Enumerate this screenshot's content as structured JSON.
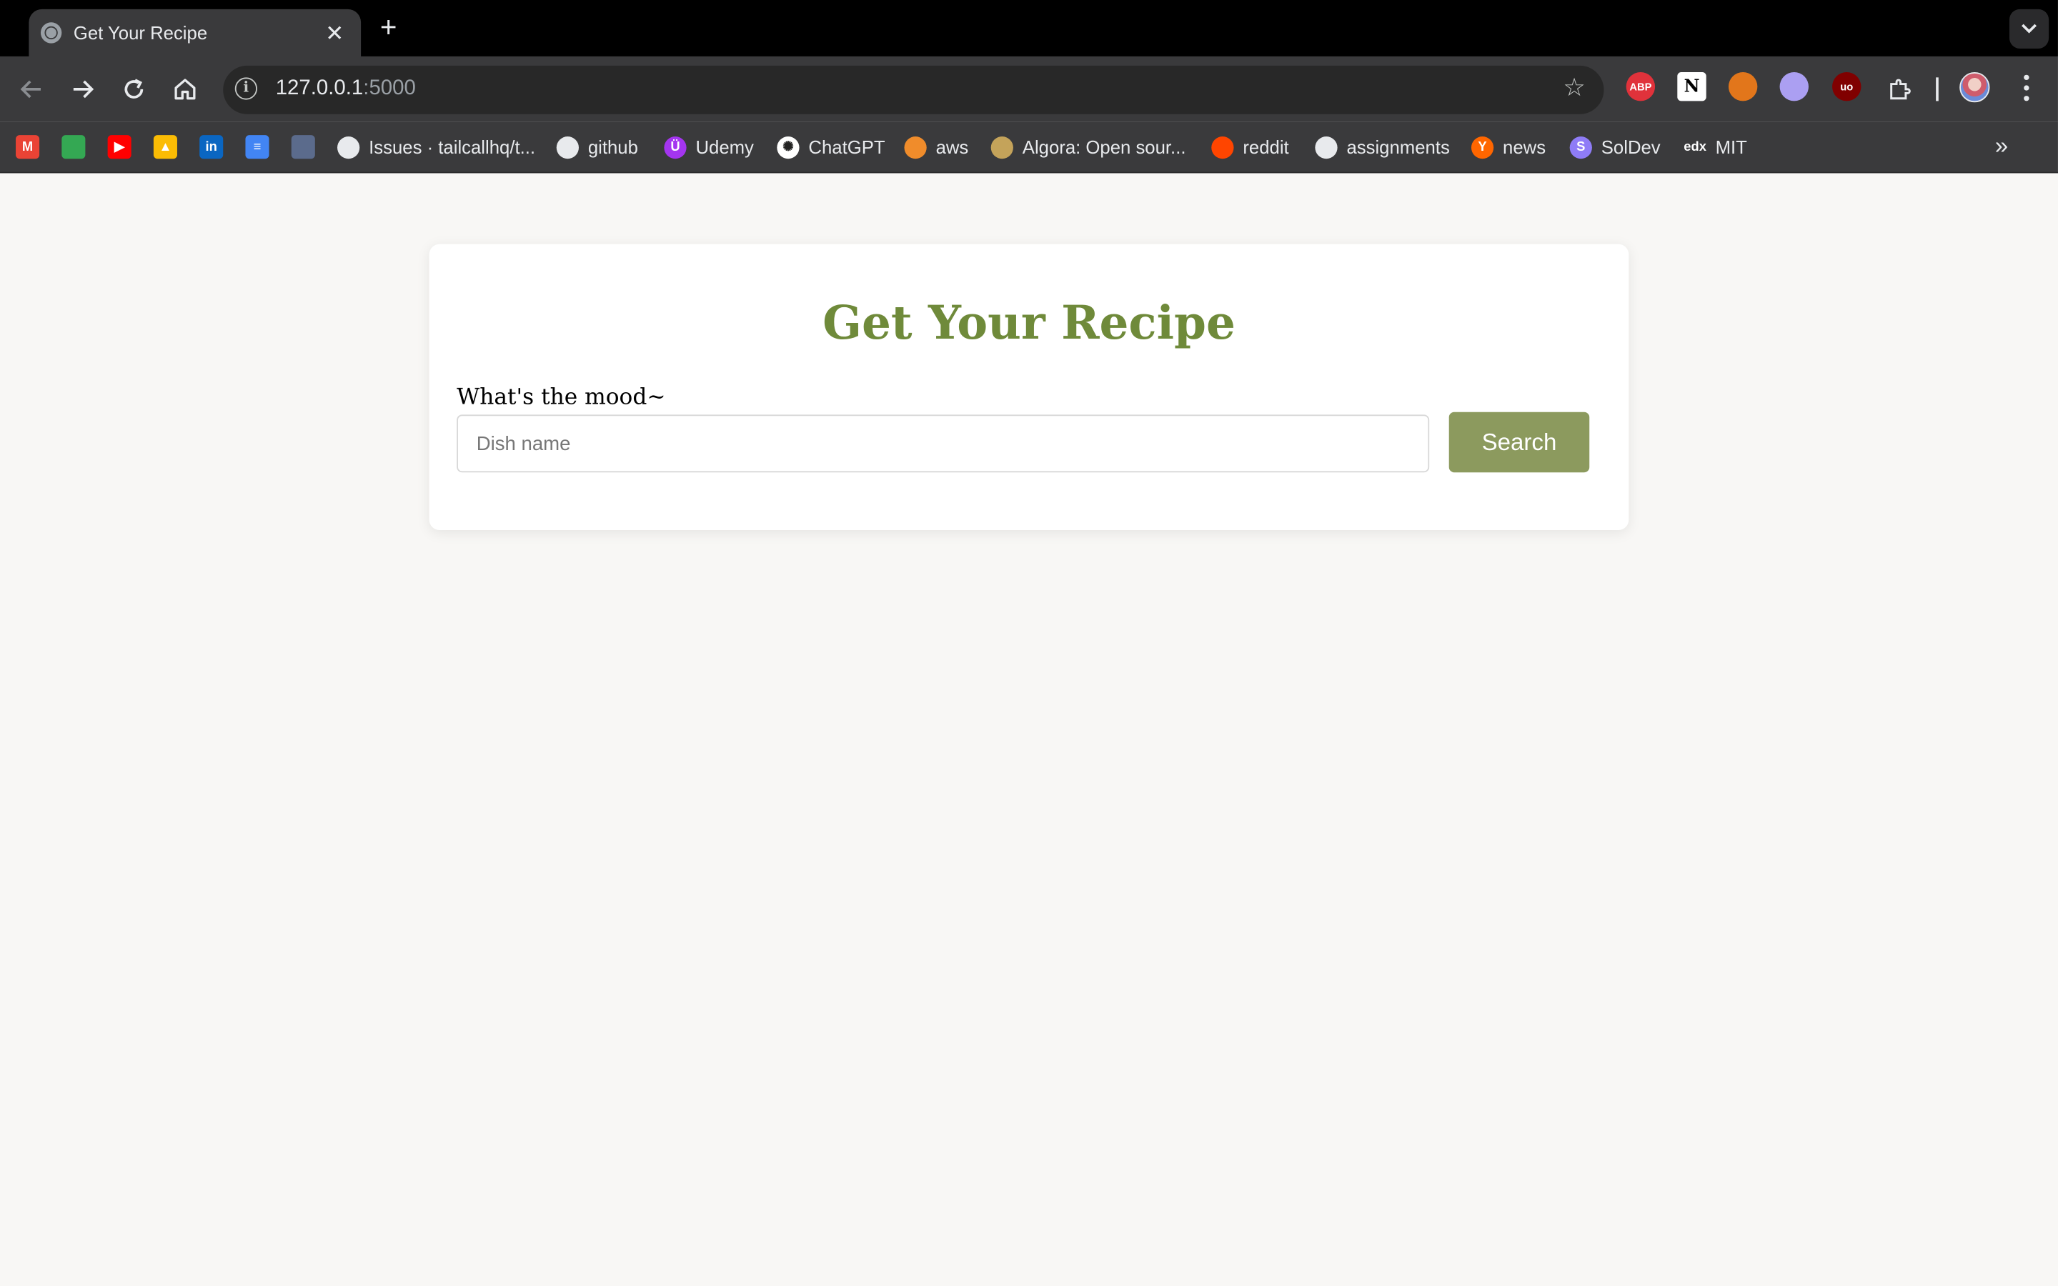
{
  "browser": {
    "tab_title": "Get Your Recipe",
    "tab_close_glyph": "✕",
    "new_tab_glyph": "+",
    "url_host": "127.0.0.1",
    "url_port": ":5000",
    "extensions": [
      {
        "name": "abp-icon",
        "label": "ABP",
        "color": "#e0323b"
      },
      {
        "name": "notion-icon",
        "label": "N",
        "color": "#ffffff"
      },
      {
        "name": "metamask-icon",
        "label": "",
        "color": "#e2761b"
      },
      {
        "name": "phantom-icon",
        "label": "",
        "color": "#ab9ff2"
      },
      {
        "name": "ublock-icon",
        "label": "uo",
        "color": "#800000"
      }
    ]
  },
  "bookmarks": {
    "icon_only": [
      {
        "name": "gmail-icon",
        "glyph": "M",
        "color": "#ea4335"
      },
      {
        "name": "maps-icon",
        "glyph": "",
        "color": "#34a853"
      },
      {
        "name": "youtube-icon",
        "glyph": "▶",
        "color": "#ff0000"
      },
      {
        "name": "drive-icon",
        "glyph": "▲",
        "color": "#fbbc04"
      },
      {
        "name": "linkedin-icon",
        "glyph": "in",
        "color": "#0a66c2"
      },
      {
        "name": "docs-icon",
        "glyph": "≡",
        "color": "#4285f4"
      },
      {
        "name": "profile-icon",
        "glyph": "",
        "color": "#5b6b8c"
      }
    ],
    "items": [
      {
        "label": "Issues · tailcallhq/t...",
        "icon": "github-icon",
        "glyph": "",
        "color": "#e8eaed"
      },
      {
        "label": "github",
        "icon": "github-icon",
        "glyph": "",
        "color": "#e8eaed"
      },
      {
        "label": "Udemy",
        "icon": "udemy-icon",
        "glyph": "Ü",
        "color": "#a435f0"
      },
      {
        "label": "ChatGPT",
        "icon": "chatgpt-icon",
        "glyph": "✺",
        "color": "#ffffff"
      },
      {
        "label": "aws",
        "icon": "aws-icon",
        "glyph": "",
        "color": "#f08c2b"
      },
      {
        "label": "Algora: Open sour...",
        "icon": "algora-icon",
        "glyph": "",
        "color": "#c4a35a"
      },
      {
        "label": "reddit",
        "icon": "reddit-icon",
        "glyph": "",
        "color": "#ff4500"
      },
      {
        "label": "assignments",
        "icon": "github-icon",
        "glyph": "",
        "color": "#e8eaed"
      },
      {
        "label": "news",
        "icon": "hackernews-icon",
        "glyph": "Y",
        "color": "#ff6600"
      },
      {
        "label": "SolDev",
        "icon": "soldev-icon",
        "glyph": "S",
        "color": "#8f7cf7"
      },
      {
        "label": "MIT",
        "icon": "edx-icon",
        "glyph": "edx",
        "color": "#3a3a3c"
      }
    ],
    "more_glyph": "»"
  },
  "page": {
    "title": "Get Your Recipe",
    "mood_label": "What's the mood~",
    "dish_placeholder": "Dish name",
    "dish_value": "",
    "search_label": "Search",
    "accent_color": "#6f8a3a",
    "button_color": "#8c9a5e",
    "background_color": "#f8f7f5"
  }
}
